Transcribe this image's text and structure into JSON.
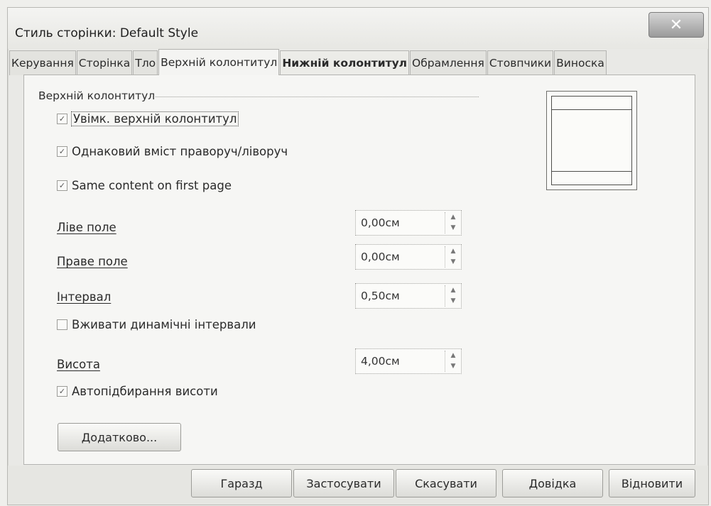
{
  "window": {
    "title": "Стиль сторінки: Default Style",
    "close_glyph": "✕"
  },
  "tabs": [
    {
      "label": "Керування"
    },
    {
      "label": "Сторінка"
    },
    {
      "label": "Тло"
    },
    {
      "label": "Верхній колонтитул"
    },
    {
      "label": "Нижній колонтитул"
    },
    {
      "label": "Обрамлення"
    },
    {
      "label": "Стовпчики"
    },
    {
      "label": "Виноска"
    }
  ],
  "header_section": {
    "title": "Верхній колонтитул",
    "checkboxes": {
      "enable": {
        "label": "Увімк. верхній колонтитул",
        "checked": true
      },
      "same_lr": {
        "label": "Однаковий вміст праворуч/ліворуч",
        "checked": true
      },
      "same_first": {
        "label": "Same content on first page",
        "checked": true
      },
      "dynamic": {
        "label": "Вживати динамічні інтервали",
        "checked": false
      },
      "autofit": {
        "label": "Автопідбирання висоти",
        "checked": true
      }
    },
    "fields": {
      "left_margin": {
        "label": "Ліве поле",
        "value": "0,00см"
      },
      "right_margin": {
        "label": "Праве поле",
        "value": "0,00см"
      },
      "spacing": {
        "label": "Інтервал",
        "value": "0,50см"
      },
      "height": {
        "label": "Висота",
        "value": "4,00см"
      }
    },
    "more_button": "Додатково..."
  },
  "buttons": {
    "ok": "Гаразд",
    "apply": "Застосувати",
    "cancel": "Скасувати",
    "help": "Довідка",
    "reset": "Відновити"
  },
  "icons": {
    "checkmark": "✓",
    "spin_up": "▲",
    "spin_down": "▼"
  }
}
